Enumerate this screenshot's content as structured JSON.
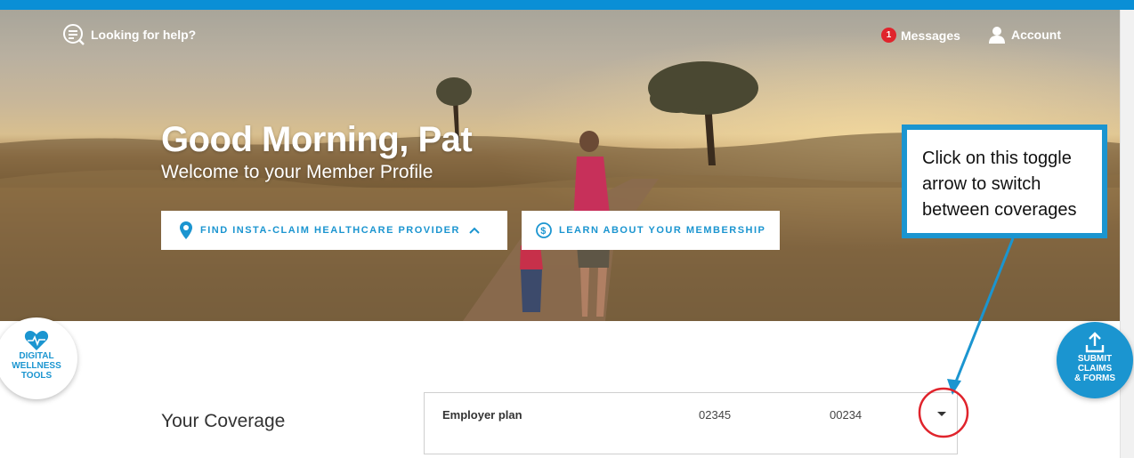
{
  "header": {
    "help_label": "Looking for help?",
    "messages_count": "1",
    "messages_label": "Messages",
    "account_label": "Account"
  },
  "hero": {
    "greeting": "Good Morning, Pat",
    "subtitle": "Welcome to your Member Profile",
    "find_provider_label": "FIND INSTA-CLAIM HEALTHCARE PROVIDER",
    "learn_membership_label": "LEARN ABOUT YOUR MEMBERSHIP"
  },
  "floating": {
    "wellness_label": "DIGITAL\nWELLNESS\nTOOLS",
    "submit_label": "SUBMIT\nCLAIMS\n& FORMS"
  },
  "coverage": {
    "title": "Your Coverage",
    "plan_name": "Employer plan",
    "number_1": "02345",
    "number_2": "00234"
  },
  "annotation": {
    "callout_text": "Click on this toggle\narrow to switch\nbetween coverages"
  },
  "colors": {
    "brand_blue": "#1b95d0",
    "top_strip": "#0a8fd6",
    "badge_red": "#e0242c",
    "annotation_circle": "#e0242c"
  },
  "icons": {
    "help": "search-chat-icon",
    "account": "user-icon",
    "find_provider": "map-pin-icon",
    "learn": "dollar-circle-icon",
    "chevron": "chevron-up-icon",
    "wellness": "heart-pulse-icon",
    "submit": "upload-icon",
    "toggle": "caret-down-icon"
  }
}
